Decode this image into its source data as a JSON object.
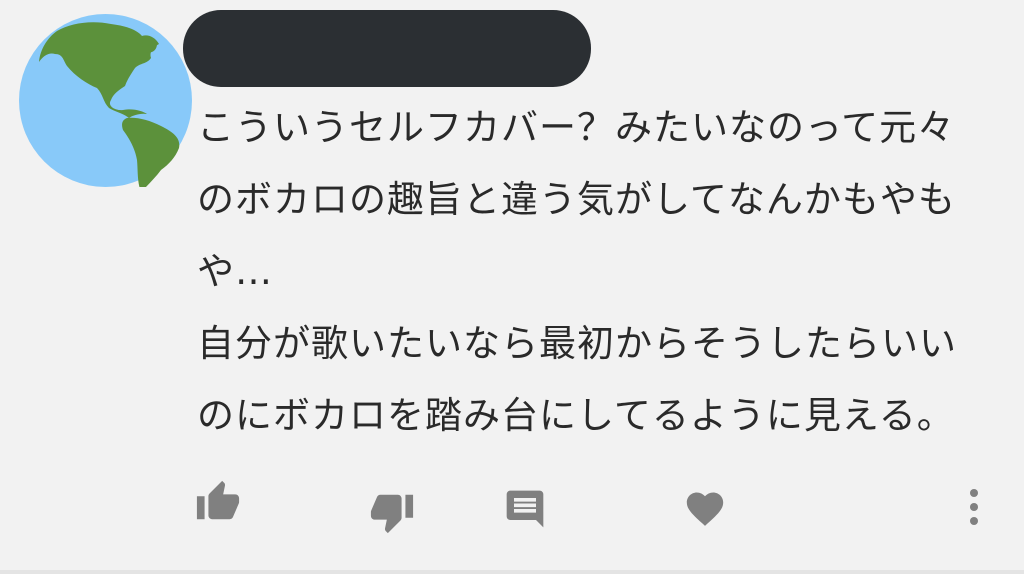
{
  "comment": {
    "author_name": "",
    "text_lines": [
      "こういうセルフカバー？みたいなのって元々",
      "のボカロの趣旨と違う気がしてなんかもやも",
      "や…",
      "自分が歌いたいなら最初からそうしたらいい",
      "のにボカロを踏み台にしてるように見える。"
    ]
  },
  "icons": {
    "avatar": "globe-americas-icon",
    "like": "thumb-up-icon",
    "dislike": "thumb-down-icon",
    "reply": "comment-icon",
    "heart": "heart-icon",
    "more": "more-vertical-icon"
  },
  "colors": {
    "background": "#f2f2f2",
    "redaction": "#2b2f33",
    "text": "#2a2a2a",
    "icon": "#808080",
    "globe_water": "#88c9f9",
    "globe_land": "#5c913b"
  }
}
